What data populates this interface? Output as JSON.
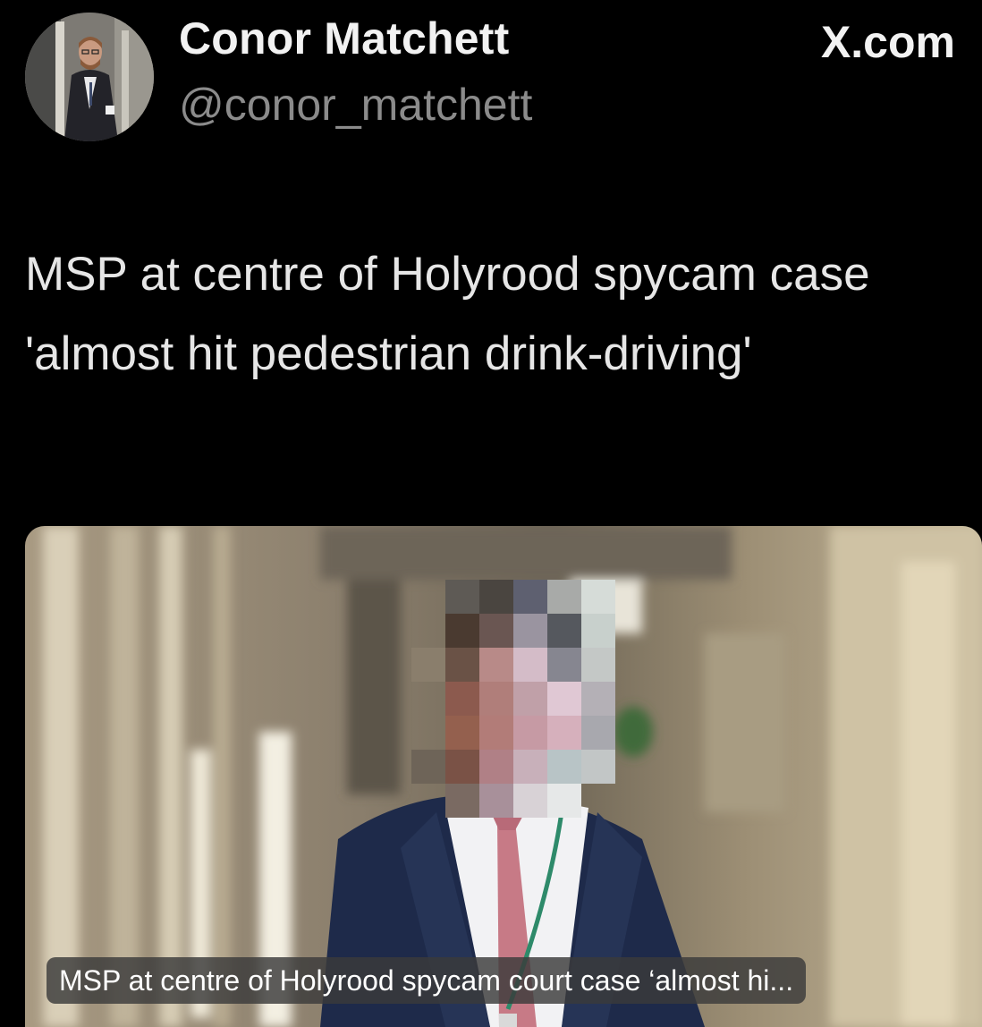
{
  "author": {
    "display_name": "Conor Matchett",
    "handle": "@conor_matchett"
  },
  "brand": {
    "label": "X.com"
  },
  "tweet": {
    "text": "MSP at centre of Holyrood spycam case 'almost hit pedestrian drink-driving'"
  },
  "link_card": {
    "caption": "MSP at centre of Holyrood spycam court case ‘almost hi..."
  },
  "icons": {
    "avatar": "profile-photo",
    "card_image": "pixelated-news-photo"
  },
  "colors": {
    "background": "#000000",
    "name_text": "#f2f2f2",
    "handle_text": "#8b8b8b",
    "tweet_text": "#e6e6e6",
    "caption_bg": "#3a3a3a"
  }
}
